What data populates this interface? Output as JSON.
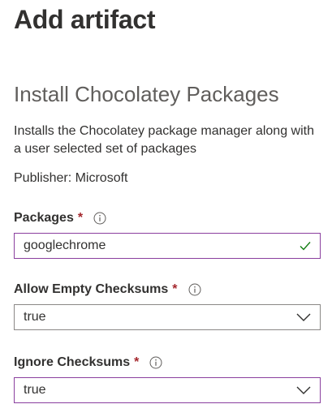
{
  "panel": {
    "title": "Add artifact"
  },
  "artifact": {
    "name": "Install Chocolatey Packages",
    "description": "Installs the Chocolatey package manager along with a user selected set of packages",
    "publisher": "Publisher: Microsoft"
  },
  "fields": {
    "packages": {
      "label": "Packages",
      "required_marker": "*",
      "value": "googlechrome",
      "icon": "info-icon",
      "status_icon": "checkmark-icon"
    },
    "allow_empty_checksums": {
      "label": "Allow Empty Checksums",
      "required_marker": "*",
      "value": "true",
      "icon": "info-icon"
    },
    "ignore_checksums": {
      "label": "Ignore Checksums",
      "required_marker": "*",
      "value": "true",
      "icon": "info-icon"
    }
  },
  "colors": {
    "focus_border": "#8a3f9e",
    "required": "#a4262c",
    "valid_check": "#107c10",
    "text": "#323130",
    "subtitle": "#605e5c"
  }
}
